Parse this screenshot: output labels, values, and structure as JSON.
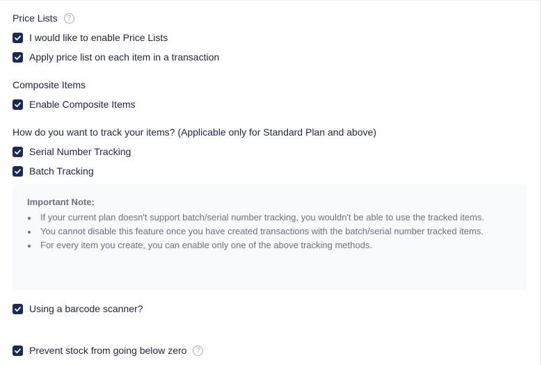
{
  "price_lists": {
    "heading": "Price Lists",
    "options": [
      {
        "label": "I would like to enable Price Lists",
        "checked": true
      },
      {
        "label": "Apply price list on each item in a transaction",
        "checked": true
      }
    ]
  },
  "composite_items": {
    "heading": "Composite Items",
    "options": [
      {
        "label": "Enable Composite Items",
        "checked": true
      }
    ]
  },
  "tracking": {
    "heading": "How do you want to track your items? (Applicable only for Standard Plan and above)",
    "options": [
      {
        "label": "Serial Number Tracking",
        "checked": true
      },
      {
        "label": "Batch Tracking",
        "checked": true
      }
    ]
  },
  "important_note": {
    "title": "Important Note:",
    "items": [
      "If your current plan doesn't support batch/serial number tracking, you wouldn't be able to use the tracked items.",
      "You cannot disable this feature once you have created transactions with the batch/serial number tracked items.",
      "For every item you create, you can enable only one of the above tracking methods."
    ]
  },
  "barcode": {
    "label": "Using a barcode scanner?",
    "checked": true
  },
  "prevent_stock": {
    "label": "Prevent stock from going below zero",
    "checked": true
  },
  "icons": {
    "help": "help-circle-icon",
    "check": "checkmark-icon",
    "help_glyph": "?"
  },
  "colors": {
    "checkbox_fill": "#1c2a4d",
    "note_background": "#f8f9fb",
    "note_text": "#6b7080"
  }
}
